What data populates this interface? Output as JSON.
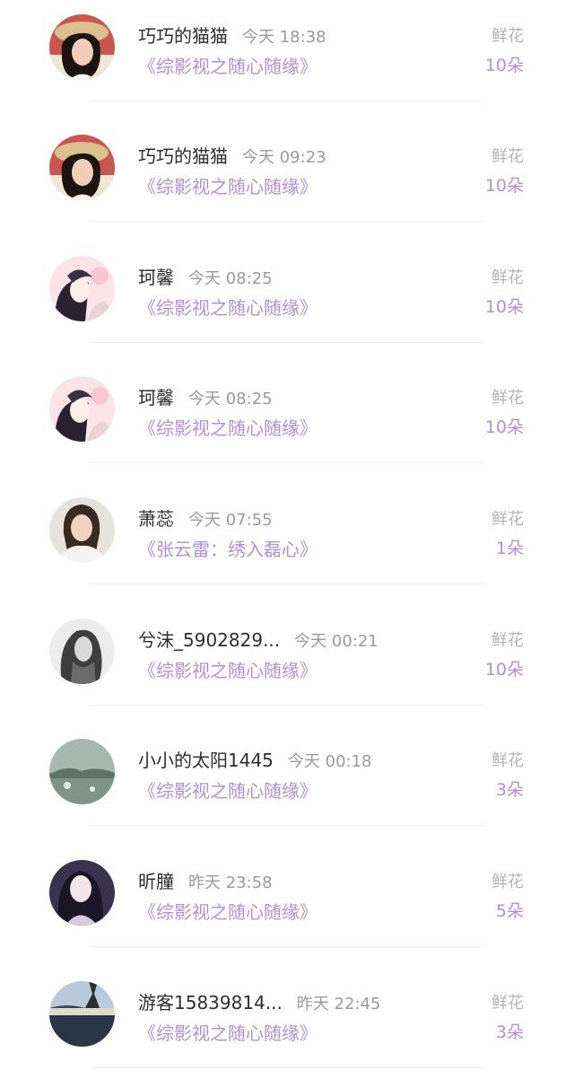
{
  "flower_label": "鲜花",
  "accent_color": "#b38fd6",
  "items": [
    {
      "name": "巧巧的猫猫",
      "time": "今天 18:38",
      "book": "《综影视之随心随缘》",
      "count": "10朵",
      "avatar": "avatar-woman-red-hat"
    },
    {
      "name": "巧巧的猫猫",
      "time": "今天 09:23",
      "book": "《综影视之随心随缘》",
      "count": "10朵",
      "avatar": "avatar-woman-red-hat"
    },
    {
      "name": "珂馨",
      "time": "今天 08:25",
      "book": "《综影视之随心随缘》",
      "count": "10朵",
      "avatar": "avatar-anime-couple"
    },
    {
      "name": "珂馨",
      "time": "今天 08:25",
      "book": "《综影视之随心随缘》",
      "count": "10朵",
      "avatar": "avatar-anime-couple"
    },
    {
      "name": "萧蕊",
      "time": "今天 07:55",
      "book": "《张云雷：绣入磊心》",
      "count": "1朵",
      "avatar": "avatar-girl-portrait"
    },
    {
      "name": "兮沫_5902829...",
      "time": "今天 00:21",
      "book": "《综影视之随心随缘》",
      "count": "10朵",
      "avatar": "avatar-grayscale-girl"
    },
    {
      "name": "小小的太阳1445",
      "time": "今天 00:18",
      "book": "《综影视之随心随缘》",
      "count": "3朵",
      "avatar": "avatar-landscape"
    },
    {
      "name": "昕朣",
      "time": "昨天 23:58",
      "book": "《综影视之随心随缘》",
      "count": "5朵",
      "avatar": "avatar-anime-girl-dark"
    },
    {
      "name": "游客15839814...",
      "time": "昨天 22:45",
      "book": "《综影视之随心随缘》",
      "count": "3朵",
      "avatar": "avatar-lake-sunset"
    }
  ]
}
